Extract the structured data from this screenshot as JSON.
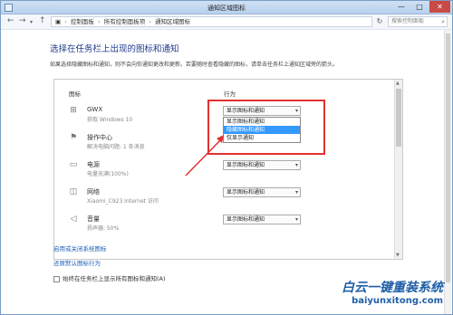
{
  "window": {
    "title": "通知区域图标",
    "min_glyph": "—",
    "max_glyph": "□",
    "close_glyph": "✕"
  },
  "address": {
    "crumbs": [
      "控制面板",
      "所有控制面板项",
      "通知区域图标"
    ],
    "separator": "›",
    "search_placeholder": "搜索控制面板"
  },
  "page": {
    "heading": "选择在任务栏上出现的图标和通知",
    "description": "如果选择隐藏图标和通知，则不会向你通知更改和更新。若要随时查看隐藏的图标，请单击任务栏上通知区域旁的箭头。"
  },
  "table": {
    "col_icon": "图标",
    "col_behavior": "行为",
    "rows": [
      {
        "icon": "windows-icon",
        "glyph": "⊞",
        "name": "GWX",
        "sub": "获取 Windows 10",
        "value": "显示图标和通知"
      },
      {
        "icon": "flag-icon",
        "glyph": "⚑",
        "name": "操作中心",
        "sub": "解决电脑问题: 1 条消息",
        "value": ""
      },
      {
        "icon": "battery-icon",
        "glyph": "▭",
        "name": "电源",
        "sub": "电量充满(100%)",
        "value": "显示图标和通知"
      },
      {
        "icon": "network-icon",
        "glyph": "◫",
        "name": "网络",
        "sub": "Xiaomi_C923 Internet 访问",
        "value": "显示图标和通知"
      },
      {
        "icon": "speaker-icon",
        "glyph": "◁",
        "name": "音量",
        "sub": "扬声器: 50%",
        "value": "显示图标和通知"
      }
    ],
    "dropdown_options": [
      "显示图标和通知",
      "隐藏图标和通知",
      "仅显示通知"
    ],
    "dropdown_selected_index": 1
  },
  "links": {
    "system_icons": "启用或关闭系统图标",
    "restore": "还原默认图标行为"
  },
  "checkbox": {
    "label": "始终在任务栏上显示所有图标和通知(A)"
  },
  "watermark": {
    "cn": "白云一键重装系统",
    "url": "baiyunxitong.com"
  },
  "colors": {
    "highlight": "#e23030",
    "selected": "#3399ff",
    "link": "#1e5fb5",
    "heading": "#1e3a8c"
  }
}
